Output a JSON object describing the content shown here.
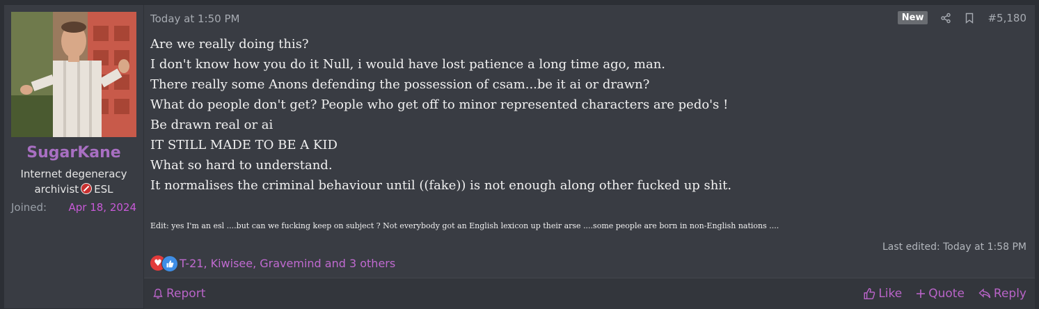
{
  "user": {
    "name": "SugarKane",
    "title_line1": "Internet degeneracy",
    "title_line2_a": "archivist",
    "title_line2_b": "ESL",
    "joined_label": "Joined:",
    "joined_date": "Apr 18, 2024"
  },
  "post": {
    "time": "Today at 1:50 PM",
    "badge": "New",
    "number": "#5,180",
    "lines": [
      "Are we really doing this?",
      "I don't know how you do it Null, i would have lost patience a long time ago, man.",
      "There really some Anons defending the possession of csam...be it ai or drawn?",
      "What do people don't get? People who get off to minor represented characters are pedo's !",
      "Be drawn real or ai",
      "IT STILL MADE TO BE A KID",
      "What so hard to understand.",
      "It normalises the criminal behaviour until ((fake)) is not enough along other fucked up shit."
    ],
    "edit_note": "Edit: yes I'm an esl ....but can we fucking keep on subject ? Not everybody got an English lexicon up their arse ....some people are born in non-English nations ....",
    "last_edited": "Last edited: Today at 1:58 PM",
    "reactions_text": "T-21, Kiwisee, Gravemind and 3 others"
  },
  "actions": {
    "report": "Report",
    "like": "Like",
    "quote": "Quote",
    "reply": "Reply"
  },
  "colors": {
    "username": "#a86fc2",
    "accent": "#b964c8",
    "joined_date": "#c85ad8"
  },
  "icons": [
    "share-icon",
    "bookmark-icon",
    "bell-icon",
    "thumbs-up-icon",
    "plus-icon",
    "reply-arrow-icon",
    "heart-reaction-icon",
    "like-reaction-icon",
    "no-sign-icon"
  ]
}
